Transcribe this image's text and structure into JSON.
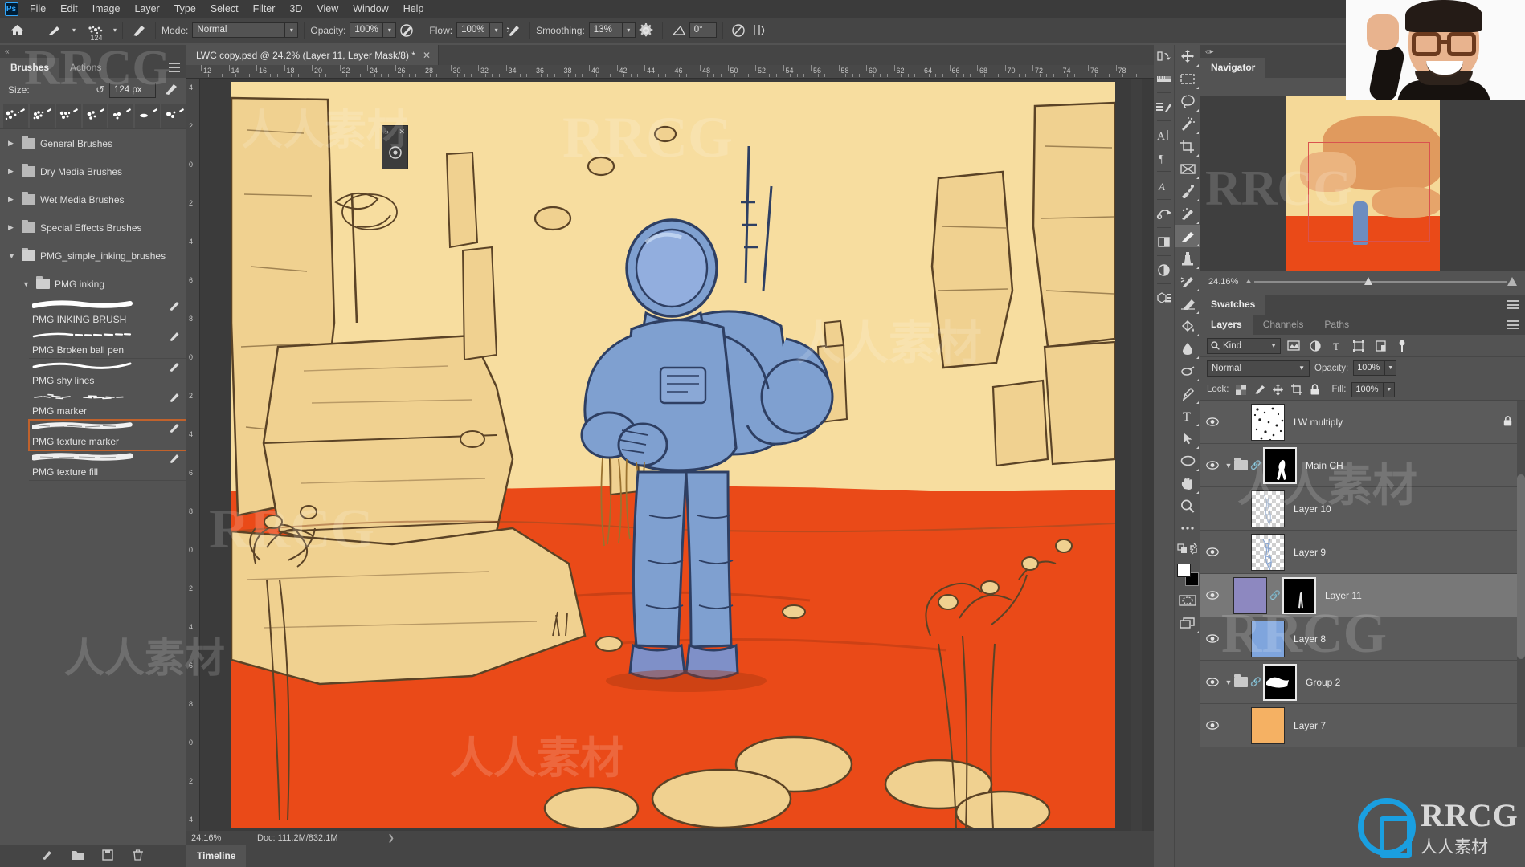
{
  "app": {
    "logo": "Ps"
  },
  "menubar": {
    "items": [
      "File",
      "Edit",
      "Image",
      "Layer",
      "Type",
      "Select",
      "Filter",
      "3D",
      "View",
      "Window",
      "Help"
    ]
  },
  "options_bar": {
    "home_icon": "home-icon",
    "brush_preset_icon": "brush-preset-icon",
    "brush_size_number": "124",
    "brush_settings_icon": "brush-settings-icon",
    "mode_label": "Mode:",
    "mode_value": "Normal",
    "opacity_label": "Opacity:",
    "opacity_value": "100%",
    "pressure_opacity_icon": "pressure-opacity-icon",
    "flow_label": "Flow:",
    "flow_value": "100%",
    "airbrush_icon": "airbrush-icon",
    "smoothing_label": "Smoothing:",
    "smoothing_value": "13%",
    "smoothing_gear_icon": "gear-icon",
    "angle_icon": "angle-icon",
    "angle_value": "0°",
    "pressure_size_icon": "pressure-size-icon",
    "symmetry_icon": "symmetry-icon"
  },
  "brushes_panel": {
    "collapse_icon": "collapse-left-icon",
    "tabs": [
      {
        "label": "Brushes",
        "active": true
      },
      {
        "label": "Actions",
        "active": false
      }
    ],
    "menu_icon": "panel-menu-icon",
    "size_label": "Size:",
    "size_reset_icon": "reset-icon",
    "size_value": "124 px",
    "brush_tip_icon": "brush-tip-icon",
    "stamp_count": 7,
    "tree": [
      {
        "label": "General Brushes",
        "expanded": false,
        "indent": 0
      },
      {
        "label": "Dry Media Brushes",
        "expanded": false,
        "indent": 0
      },
      {
        "label": "Wet Media Brushes",
        "expanded": false,
        "indent": 0
      },
      {
        "label": "Special Effects Brushes",
        "expanded": false,
        "indent": 0
      },
      {
        "label": "PMG_simple_inking_brushes",
        "expanded": true,
        "indent": 0
      },
      {
        "label": "PMG inking",
        "expanded": true,
        "indent": 1
      }
    ],
    "brushes": [
      {
        "name": "PMG INKING BRUSH",
        "selected": false,
        "stroke": "thick-smooth"
      },
      {
        "name": "PMG Broken ball pen",
        "selected": false,
        "stroke": "thin-broken"
      },
      {
        "name": "PMG shy lines",
        "selected": false,
        "stroke": "thin-smooth"
      },
      {
        "name": "PMG marker",
        "selected": false,
        "stroke": "sparse-dash"
      },
      {
        "name": "PMG texture marker",
        "selected": true,
        "stroke": "rough-textured"
      },
      {
        "name": "PMG texture fill",
        "selected": false,
        "stroke": "wide-textured"
      }
    ],
    "footer_icons": [
      "new-brush-icon",
      "folder-icon",
      "save-icon",
      "delete-icon"
    ]
  },
  "document": {
    "tab_title": "LWC copy.psd @ 24.2% (Layer 11, Layer Mask/8) *",
    "close_icon": "close-icon",
    "ruler_ticks": [
      12,
      14,
      16,
      18,
      20,
      22,
      24,
      26,
      28,
      30,
      32,
      34,
      36,
      38,
      40,
      42,
      44,
      46,
      48,
      50,
      52,
      54,
      56,
      58,
      60,
      62,
      64,
      66,
      68,
      70,
      72,
      74,
      76,
      78
    ],
    "ruler_v_ticks": [
      4,
      2,
      0,
      2,
      4,
      6,
      8,
      0,
      2,
      4,
      6,
      8,
      0,
      2,
      4,
      6,
      8,
      0,
      2,
      4
    ],
    "artwork_colors": {
      "sky": "#f7dd9f",
      "ground": "#ea4a18",
      "rock": "#f0d190",
      "ink": "#5b4326",
      "suit": "#7fa0d0",
      "suit_outline": "#2e3f63"
    }
  },
  "status_bar": {
    "zoom": "24.16%",
    "doc": "Doc: 111.2M/832.1M",
    "expand_icon": "chevron-right-icon"
  },
  "timeline": {
    "tab_label": "Timeline"
  },
  "toolbar": {
    "strip_a": [
      "shape-burst-icon",
      "ruler-measure-icon",
      "brush-settings-list-icon",
      "character-icon",
      "paragraph-icon",
      "character-style-icon",
      "path-select-icon",
      "frame-icon",
      "adjustment-icon",
      "3d-icon"
    ],
    "strip_b": [
      "move-icon",
      "marquee-icon",
      "lasso-icon",
      "magic-wand-icon",
      "crop-icon",
      "slice-icon",
      "eyedropper-icon",
      "healing-brush-icon",
      "brush-icon",
      "clone-stamp-icon",
      "history-brush-icon",
      "eraser-icon",
      "paint-bucket-icon",
      "blur-icon",
      "dodge-icon",
      "pen-icon",
      "type-icon",
      "path-selection-icon",
      "shape-icon",
      "hand-icon",
      "zoom-icon",
      "more-tools-icon"
    ],
    "active_tool": "brush-icon",
    "quick_mask_icon": "quick-mask-icon",
    "screen_mode_icon": "screen-mode-icon",
    "swap_colors_icon": "swap-colors-icon",
    "default_colors_icon": "default-colors-icon",
    "foreground_color": "#ffffff",
    "background_color": "#000000"
  },
  "navigator": {
    "collapse_icon": "collapse-right-icon",
    "tab_label": "Navigator",
    "menu_icon": "panel-menu-icon",
    "zoom_value": "24.16%"
  },
  "swatches": {
    "tab_label": "Swatches",
    "menu_icon": "panel-menu-icon"
  },
  "layers_panel": {
    "tabs": [
      {
        "label": "Layers",
        "active": true
      },
      {
        "label": "Channels",
        "active": false
      },
      {
        "label": "Paths",
        "active": false
      }
    ],
    "menu_icon": "panel-menu-icon",
    "filter": {
      "search_icon": "search-icon",
      "kind_label": "Kind",
      "dropdown_icon": "chevron-down-icon",
      "icons": [
        "pixel-filter-icon",
        "adjustment-filter-icon",
        "type-filter-icon",
        "shape-filter-icon",
        "smart-object-filter-icon"
      ],
      "toggle_icon": "filter-toggle-icon"
    },
    "blend_mode_label": "Normal",
    "opacity_label": "Opacity:",
    "opacity_value": "100%",
    "lock_label": "Lock:",
    "lock_icons": [
      "lock-transparent-icon",
      "lock-image-icon",
      "lock-position-icon",
      "lock-artboard-icon",
      "lock-all-icon"
    ],
    "fill_label": "Fill:",
    "fill_value": "100%",
    "layers": [
      {
        "name": "LW multiply",
        "visible": true,
        "selected": false,
        "locked": true,
        "type": "layer",
        "thumb": "speckle-white"
      },
      {
        "name": "Main CH",
        "visible": true,
        "selected": false,
        "locked": false,
        "type": "group",
        "expanded": true,
        "linked": true,
        "thumb": "black-mask"
      },
      {
        "name": "Layer 10",
        "visible": false,
        "selected": false,
        "locked": false,
        "type": "layer",
        "thumb": "checker-light"
      },
      {
        "name": "Layer 9",
        "visible": true,
        "selected": false,
        "locked": false,
        "type": "layer",
        "thumb": "checker-blue"
      },
      {
        "name": "Layer 11",
        "visible": true,
        "selected": true,
        "locked": false,
        "type": "layer",
        "linked": true,
        "thumb": "solid-purple",
        "mask": "black-mask"
      },
      {
        "name": "Layer 8",
        "visible": true,
        "selected": false,
        "locked": false,
        "type": "layer",
        "thumb": "solid-blue"
      },
      {
        "name": "Group 2",
        "visible": true,
        "selected": false,
        "locked": false,
        "type": "group",
        "expanded": true,
        "linked": true,
        "thumb": "black-white-mask"
      },
      {
        "name": "Layer 7",
        "visible": true,
        "selected": false,
        "locked": false,
        "type": "layer",
        "thumb": "solid-orange"
      }
    ]
  },
  "watermarks": {
    "text_latin": "RRCG",
    "text_cn": "人人素材",
    "logo_line1": "RRCG",
    "logo_line2": "人人素材"
  }
}
